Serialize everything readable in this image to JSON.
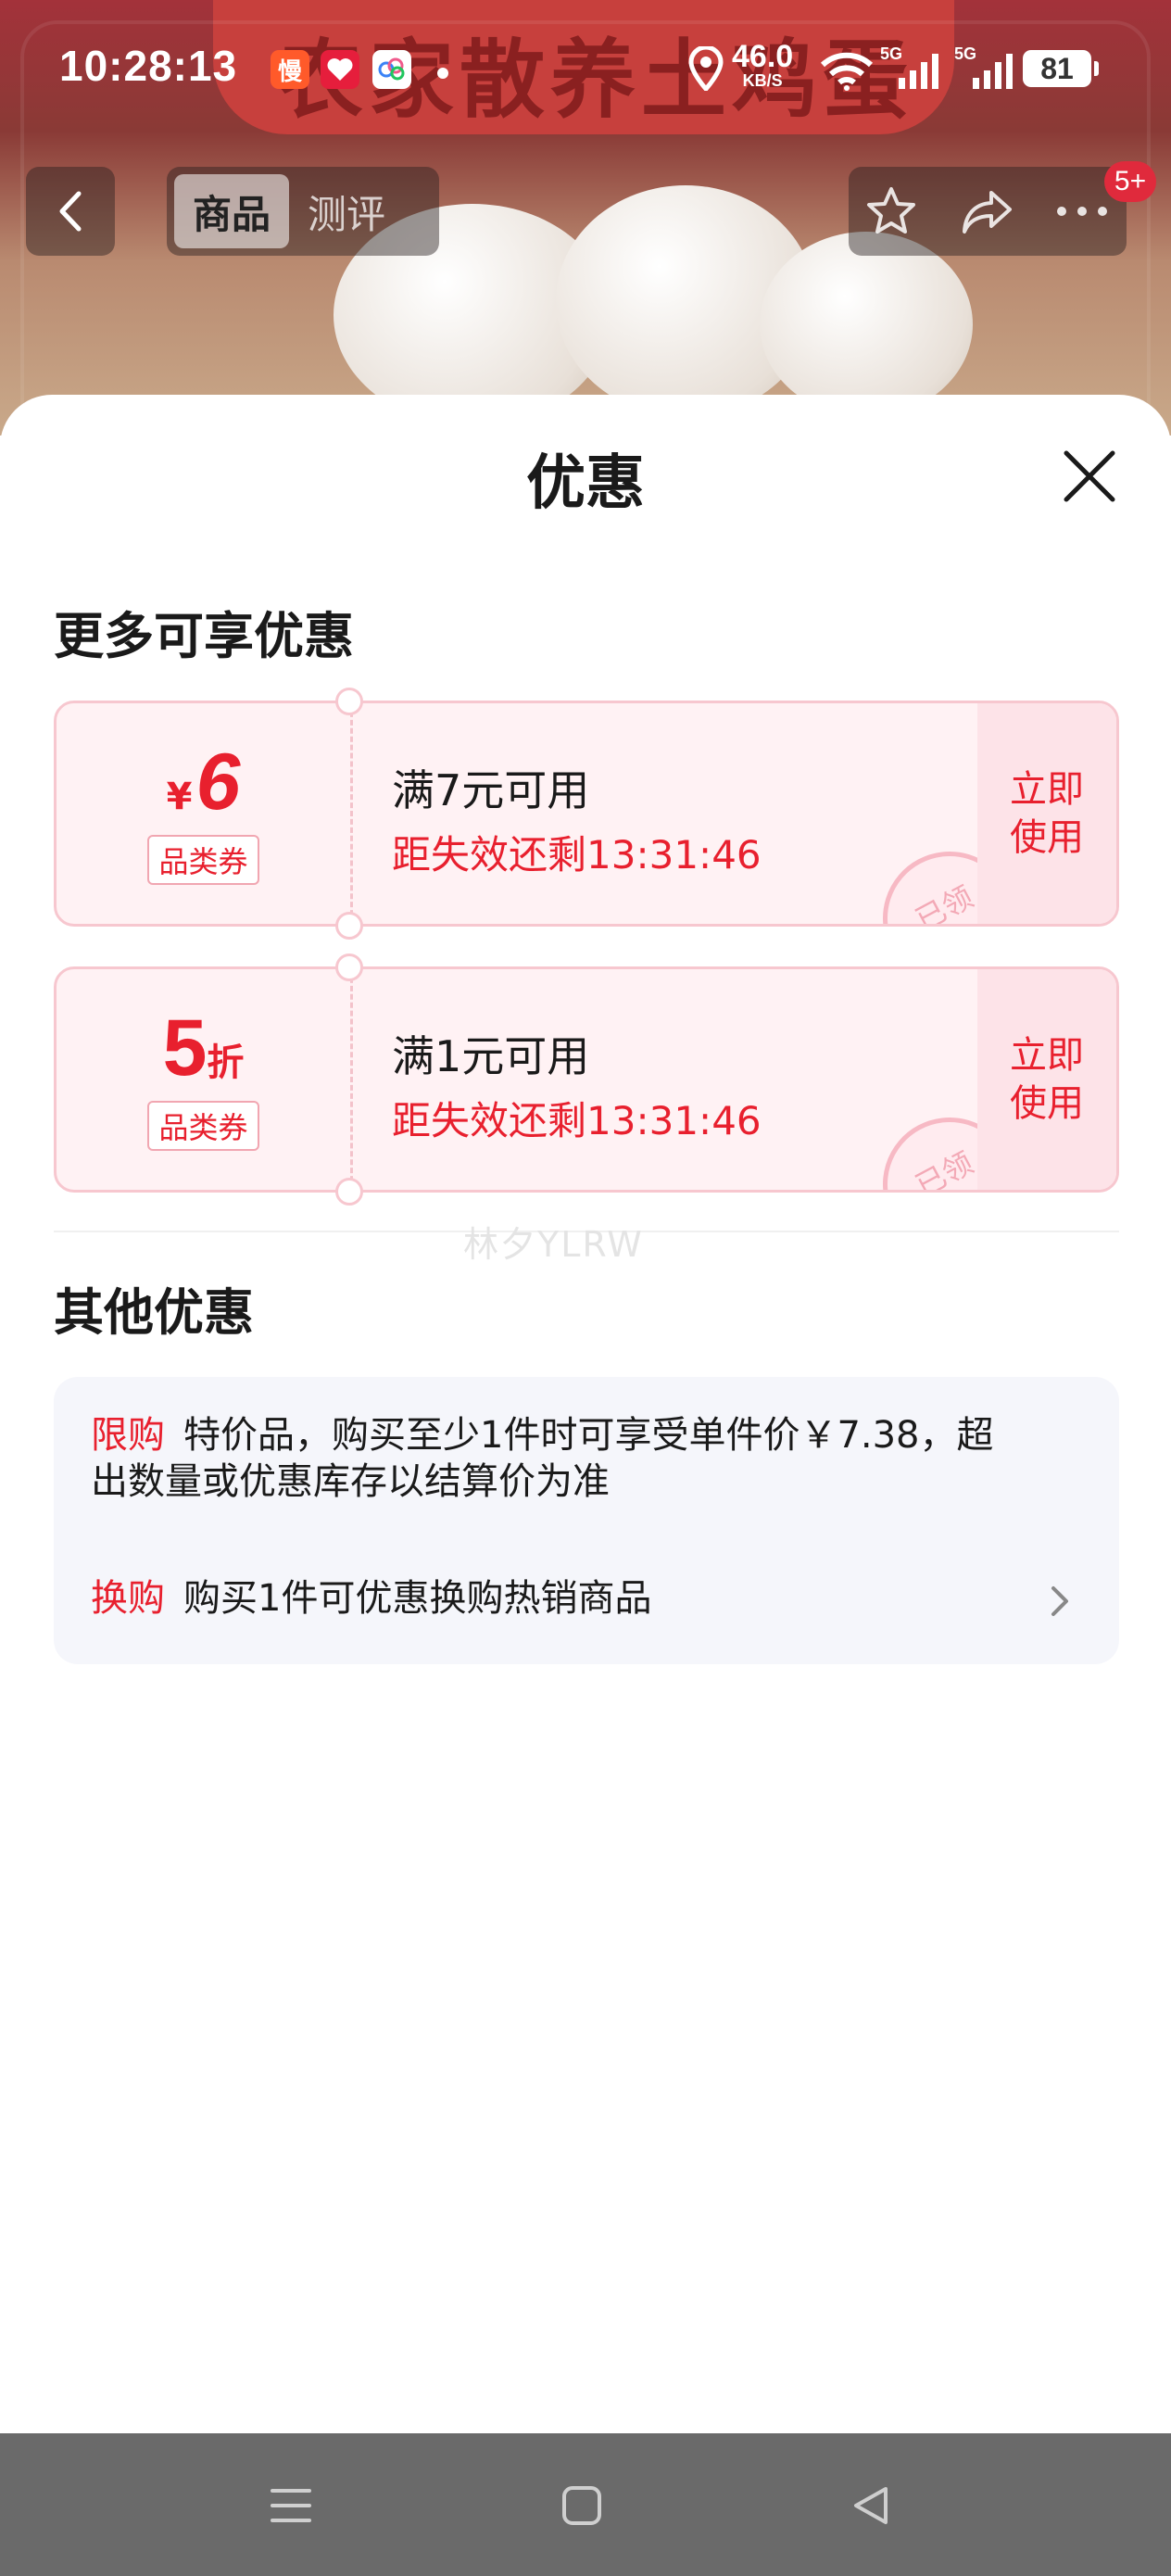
{
  "status_bar": {
    "time": "10:28:13",
    "app_icon_1": "慢",
    "net_speed": "46.0",
    "net_speed_unit": "KB/S",
    "signal_1": "5G",
    "signal_2": "5G",
    "battery": "81"
  },
  "background_page": {
    "banner_text": "农家散养土鸡蛋",
    "tabs": [
      {
        "label": "商品",
        "active": true
      },
      {
        "label": "测评",
        "active": false
      }
    ],
    "message_badge": "5+"
  },
  "sheet": {
    "title": "优惠",
    "section_more": "更多可享优惠",
    "coupons": [
      {
        "currency": "¥",
        "value": "6",
        "unit": "",
        "tag": "品类券",
        "condition": "满7元可用",
        "expiry": "距失效还剩13:31:46",
        "action": "立即使用",
        "stamp": "已领"
      },
      {
        "currency": "",
        "value": "5",
        "unit": "折",
        "tag": "品类券",
        "condition": "满1元可用",
        "expiry": "距失效还剩13:31:46",
        "action": "立即使用",
        "stamp": "已领"
      }
    ],
    "watermark": "林夕YLRW",
    "section_other": "其他优惠",
    "other_offers": [
      {
        "label": "限购",
        "text_line1": "特价品，购买至少1件时可享受单件价￥7.38，超",
        "text_line2": "出数量或优惠库存以结算价为准"
      },
      {
        "label": "换购",
        "text": "购买1件可优惠换购热销商品"
      }
    ]
  },
  "colors": {
    "accent": "#e8202e",
    "coupon_bg": "#fff2f4",
    "other_box_bg": "#f5f6fb",
    "nav_bar": "#6a6a6a"
  }
}
